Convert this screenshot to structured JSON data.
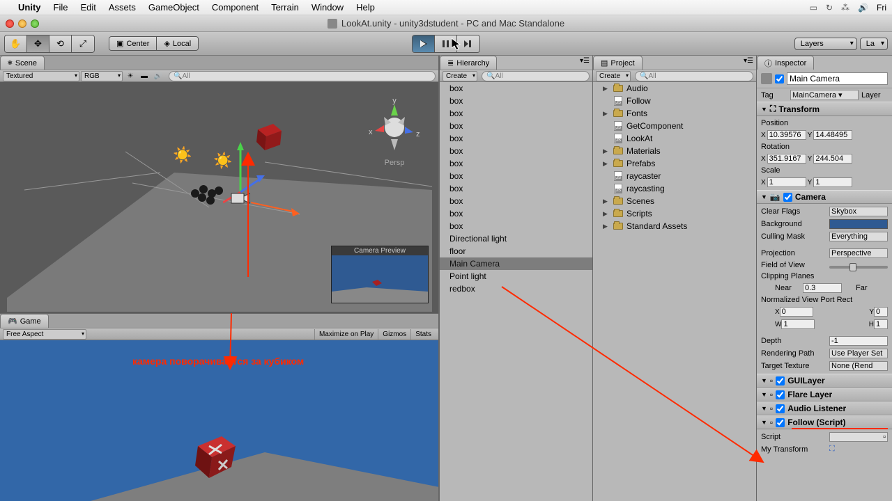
{
  "menubar": {
    "app": "Unity",
    "items": [
      "File",
      "Edit",
      "Assets",
      "GameObject",
      "Component",
      "Terrain",
      "Window",
      "Help"
    ],
    "clock": "Fri"
  },
  "window": {
    "title": "LookAt.unity - unity3dstudent - PC and Mac Standalone"
  },
  "toolbar": {
    "pivot_center": "Center",
    "pivot_local": "Local",
    "layers": "Layers",
    "layout": "La"
  },
  "scene": {
    "tab": "Scene",
    "draw_mode": "Textured",
    "render_mode": "RGB",
    "search_placeholder": "All",
    "axis_y": "y",
    "axis_x": "x",
    "axis_z": "z",
    "persp": "Persp",
    "camera_preview": "Camera Preview"
  },
  "game": {
    "tab": "Game",
    "aspect": "Free Aspect",
    "maximize": "Maximize on Play",
    "gizmos": "Gizmos",
    "stats": "Stats"
  },
  "hierarchy": {
    "tab": "Hierarchy",
    "create": "Create",
    "search_placeholder": "All",
    "items": [
      "box",
      "box",
      "box",
      "box",
      "box",
      "box",
      "box",
      "box",
      "box",
      "box",
      "box",
      "box",
      "Directional light",
      "floor",
      "Main Camera",
      "Point light",
      "redbox"
    ],
    "selected": "Main Camera"
  },
  "project": {
    "tab": "Project",
    "create": "Create",
    "search_placeholder": "All",
    "items": [
      {
        "name": "Audio",
        "type": "folder",
        "expandable": true
      },
      {
        "name": "Follow",
        "type": "script",
        "expandable": false
      },
      {
        "name": "Fonts",
        "type": "folder",
        "expandable": true
      },
      {
        "name": "GetComponent",
        "type": "script",
        "expandable": false
      },
      {
        "name": "LookAt",
        "type": "script",
        "expandable": false
      },
      {
        "name": "Materials",
        "type": "folder",
        "expandable": true
      },
      {
        "name": "Prefabs",
        "type": "folder",
        "expandable": true
      },
      {
        "name": "raycaster",
        "type": "script",
        "expandable": false
      },
      {
        "name": "raycasting",
        "type": "script",
        "expandable": false
      },
      {
        "name": "Scenes",
        "type": "folder",
        "expandable": true
      },
      {
        "name": "Scripts",
        "type": "folder",
        "expandable": true
      },
      {
        "name": "Standard Assets",
        "type": "folder",
        "expandable": true
      }
    ]
  },
  "inspector": {
    "tab": "Inspector",
    "object_name": "Main Camera",
    "tag_label": "Tag",
    "tag": "MainCamera",
    "layer_label": "Layer",
    "transform": {
      "title": "Transform",
      "position_label": "Position",
      "pos_x": "10.39576",
      "pos_y": "14.48495",
      "rotation_label": "Rotation",
      "rot_x": "351.9167",
      "rot_y": "244.504",
      "scale_label": "Scale",
      "scl_x": "1",
      "scl_y": "1"
    },
    "camera": {
      "title": "Camera",
      "clear_flags": "Clear Flags",
      "clear_flags_v": "Skybox",
      "background": "Background",
      "background_color": "#2f5a92",
      "culling_mask": "Culling Mask",
      "culling_mask_v": "Everything",
      "projection": "Projection",
      "projection_v": "Perspective",
      "fov": "Field of View",
      "clip": "Clipping Planes",
      "near_l": "Near",
      "near": "0.3",
      "far_l": "Far",
      "nvpr": "Normalized View Port Rect",
      "vx": "0",
      "vy": "0",
      "vw": "1",
      "vh": "1",
      "depth": "Depth",
      "depth_v": "-1",
      "render_path": "Rendering Path",
      "render_path_v": "Use Player Set",
      "target_tex": "Target Texture",
      "target_tex_v": "None (Rend"
    },
    "guilayer": "GUILayer",
    "flarelayer": "Flare Layer",
    "audiolistener": "Audio Listener",
    "follow": "Follow (Script)",
    "script_l": "Script",
    "mytransform": "My Transform"
  },
  "annotation": {
    "text": "камера поворачивается за кубиком"
  },
  "chart_data": null
}
